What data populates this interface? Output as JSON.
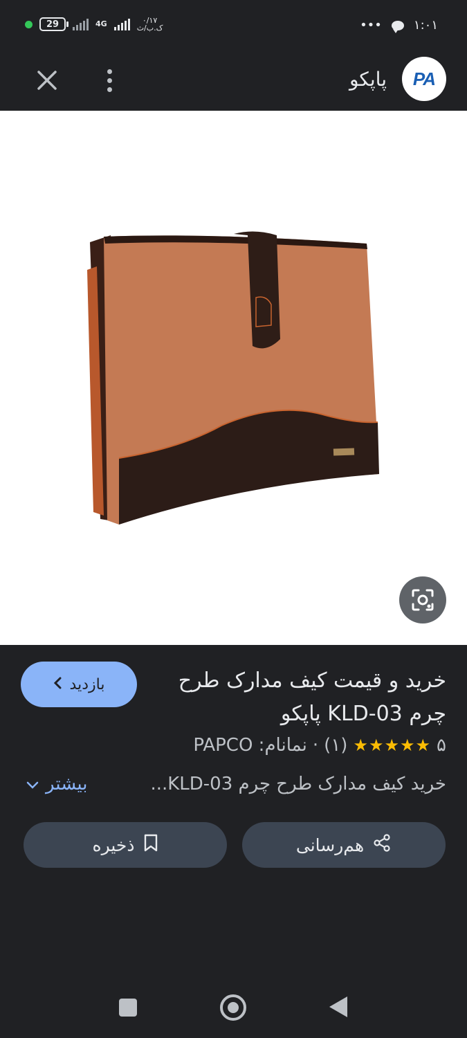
{
  "status_bar": {
    "time": "۱:۰۱",
    "battery": "29",
    "network": "4G",
    "speed_value": "۰/۱۷",
    "speed_unit": "ک.ب/ث",
    "more": "•••"
  },
  "header": {
    "site_name": "پاپکو",
    "logo_text": "PA"
  },
  "result": {
    "visit_label": "بازدید",
    "title": "خرید و قیمت کیف مدارک طرح چرم KLD-03 پاپکو",
    "rating_value": "۵",
    "stars": "★★★★★",
    "review_count": "(۱)",
    "separator": "·",
    "brand_label": "نمانام: PAPCO",
    "description": "خرید کیف مدارک طرح چرم KLD-03...",
    "more_label": "بیشتر"
  },
  "actions": {
    "share_label": "هم‌رسانی",
    "save_label": "ذخیره"
  },
  "colors": {
    "background": "#202124",
    "accent": "#8ab4f8",
    "star": "#fbbc04",
    "button_bg": "#3c4552"
  },
  "icons": [
    "close-icon",
    "more-vert-icon",
    "lens-icon",
    "chevron-left-icon",
    "chevron-down-icon",
    "share-icon",
    "bookmark-icon"
  ]
}
